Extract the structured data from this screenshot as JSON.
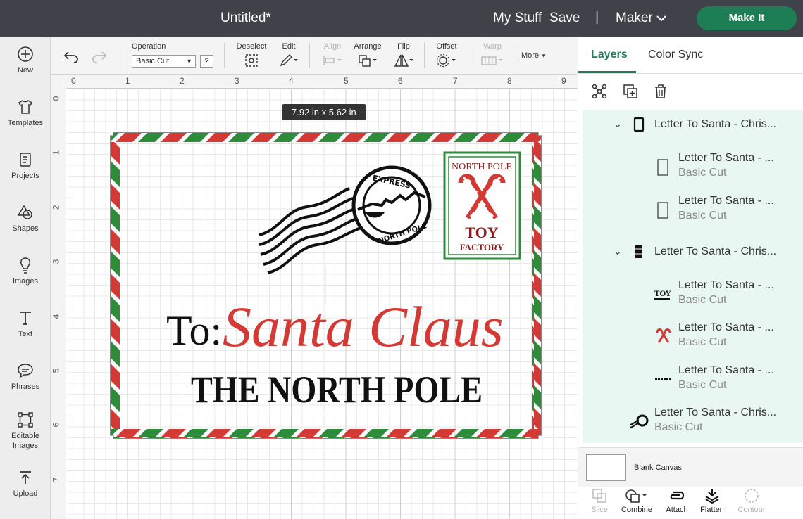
{
  "header": {
    "doc_title": "Untitled*",
    "my_stuff": "My Stuff",
    "save": "Save",
    "divider": "|",
    "machine": "Maker",
    "make_it": "Make It"
  },
  "leftbar": {
    "items": [
      {
        "label": "New",
        "icon": "plus-circle-icon"
      },
      {
        "label": "Templates",
        "icon": "shirt-icon"
      },
      {
        "label": "Projects",
        "icon": "projects-icon"
      },
      {
        "label": "Shapes",
        "icon": "shapes-icon"
      },
      {
        "label": "Images",
        "icon": "lightbulb-icon"
      },
      {
        "label": "Text",
        "icon": "text-icon"
      },
      {
        "label": "Phrases",
        "icon": "speech-bubble-icon"
      },
      {
        "label": "Editable Images",
        "icon": "editable-images-icon"
      },
      {
        "label": "Upload",
        "icon": "upload-icon"
      }
    ]
  },
  "toolbar": {
    "operation_label": "Operation",
    "operation_value": "Basic Cut",
    "help": "?",
    "deselect": "Deselect",
    "edit": "Edit",
    "align": "Align",
    "arrange": "Arrange",
    "flip": "Flip",
    "offset": "Offset",
    "warp": "Warp",
    "more": "More"
  },
  "canvas": {
    "ruler_top": [
      "0",
      "1",
      "2",
      "3",
      "4",
      "5",
      "6",
      "7",
      "8",
      "9"
    ],
    "ruler_left": [
      "0",
      "1",
      "2",
      "3",
      "4",
      "5",
      "6",
      "7"
    ],
    "dimension_label": "7.92  in x 5.62  in",
    "design": {
      "to_label": "To:",
      "recipient": "Santa Claus",
      "address": "THE NORTH POLE",
      "stamp_top": "NORTH POLE",
      "stamp_toy": "TOY",
      "stamp_factory": "FACTORY",
      "postmark_top": "EXPRESS",
      "postmark_bottom": "NORTH POLE",
      "colors": {
        "red": "#d43a35",
        "green": "#2e8b3a",
        "black": "#111111"
      }
    }
  },
  "rightpanel": {
    "tabs": [
      "Layers",
      "Color Sync"
    ],
    "active_tab": "Layers",
    "layers": [
      {
        "name": "Letter To Santa - Chris...",
        "sub": ""
      },
      {
        "name": "Letter To Santa - ...",
        "sub": "Basic Cut"
      },
      {
        "name": "Letter To Santa - ...",
        "sub": "Basic Cut"
      },
      {
        "name": "Letter To Santa - Chris...",
        "sub": ""
      },
      {
        "name": "Letter To Santa - ...",
        "sub": "Basic Cut"
      },
      {
        "name": "Letter To Santa - ...",
        "sub": "Basic Cut"
      },
      {
        "name": "Letter To Santa - ...",
        "sub": "Basic Cut"
      },
      {
        "name": "Letter To Santa - Chris...",
        "sub": "Basic Cut"
      }
    ],
    "blank_canvas": "Blank Canvas",
    "bottom_tools": [
      "Slice",
      "Combine",
      "Attach",
      "Flatten",
      "Contour"
    ]
  }
}
